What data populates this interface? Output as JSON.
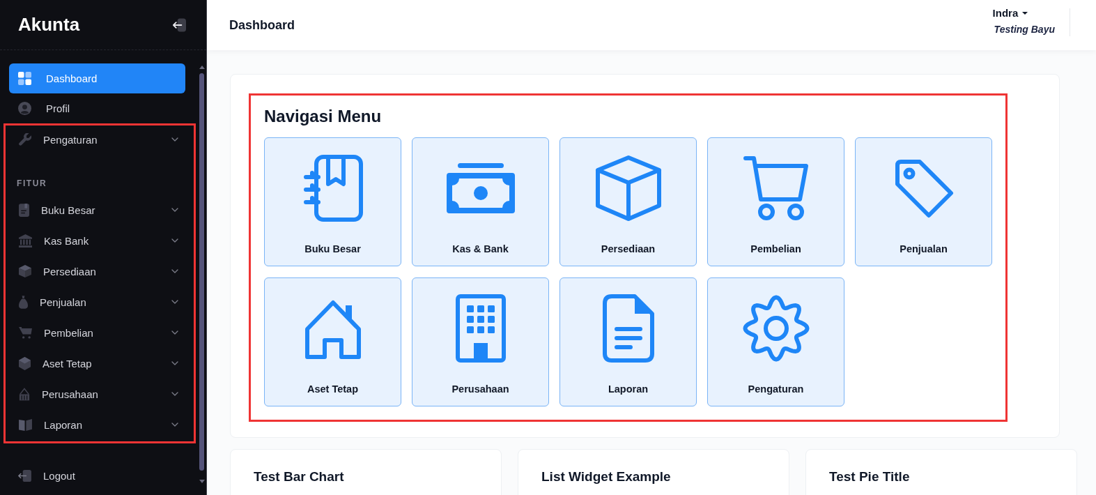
{
  "sidebar": {
    "brand": "Akunta",
    "items": [
      {
        "label": "Dashboard",
        "kind": "link",
        "selected": true
      },
      {
        "label": "Profil",
        "kind": "link",
        "selected": false
      },
      {
        "label": "Pengaturan",
        "kind": "dropdown",
        "selected": false
      }
    ],
    "section": {
      "title": "FITUR",
      "items": [
        {
          "label": "Buku Besar",
          "kind": "dropdown",
          "selected": false
        },
        {
          "label": "Kas Bank",
          "kind": "dropdown",
          "selected": false
        },
        {
          "label": "Persediaan",
          "kind": "dropdown",
          "selected": false
        },
        {
          "label": "Penjualan",
          "kind": "dropdown",
          "selected": false
        },
        {
          "label": "Pembelian",
          "kind": "dropdown",
          "selected": false
        },
        {
          "label": "Aset Tetap",
          "kind": "dropdown",
          "selected": false
        },
        {
          "label": "Perusahaan",
          "kind": "dropdown",
          "selected": false
        },
        {
          "label": "Laporan",
          "kind": "dropdown",
          "selected": false
        }
      ]
    },
    "logout": "Logout"
  },
  "header": {
    "title": "Dashboard",
    "user": {
      "name": "Indra",
      "company": "Testing Bayu"
    }
  },
  "navigation_menu": {
    "title": "Navigasi Menu",
    "tiles": [
      "Buku Besar",
      "Kas & Bank",
      "Persediaan",
      "Pembelian",
      "Penjualan",
      "Aset Tetap",
      "Perusahaan",
      "Laporan",
      "Pengaturan"
    ]
  },
  "widgets": [
    {
      "title": "Test Bar Chart"
    },
    {
      "title": "List Widget Example"
    },
    {
      "title": "Test Pie Title"
    }
  ]
}
